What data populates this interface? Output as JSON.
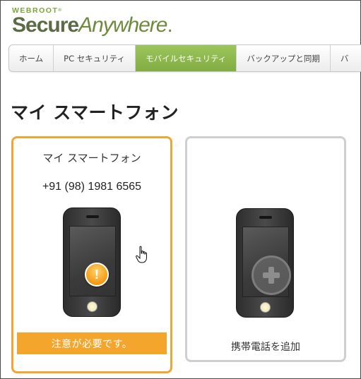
{
  "logo": {
    "brand_small": "WEBROOT",
    "trademark": "®",
    "product_bold": "Secure",
    "product_italic": "Anywhere",
    "product_dot": "."
  },
  "nav": {
    "tabs": [
      {
        "label": "ホーム",
        "active": false
      },
      {
        "label": "PC セキュリティ",
        "active": false
      },
      {
        "label": "モバイルセキュリティ",
        "active": true
      },
      {
        "label": "バックアップと同期",
        "active": false
      },
      {
        "label": "バ",
        "active": false
      }
    ]
  },
  "page": {
    "title": "マイ スマートフォン"
  },
  "device_card": {
    "name": "マイ スマートフォン",
    "phone_number": "+91 (98) 1981 6565",
    "status_icon": "warning-icon",
    "status_icon_glyph": "!",
    "status_text": "注意が必要です。",
    "accent_color": "#f2a531"
  },
  "add_card": {
    "icon": "plus-icon",
    "label": "携帯電話を追加"
  },
  "colors": {
    "nav_active": "#8cb84d",
    "logo_green": "#6e8b3d",
    "warning": "#f4a52c"
  }
}
